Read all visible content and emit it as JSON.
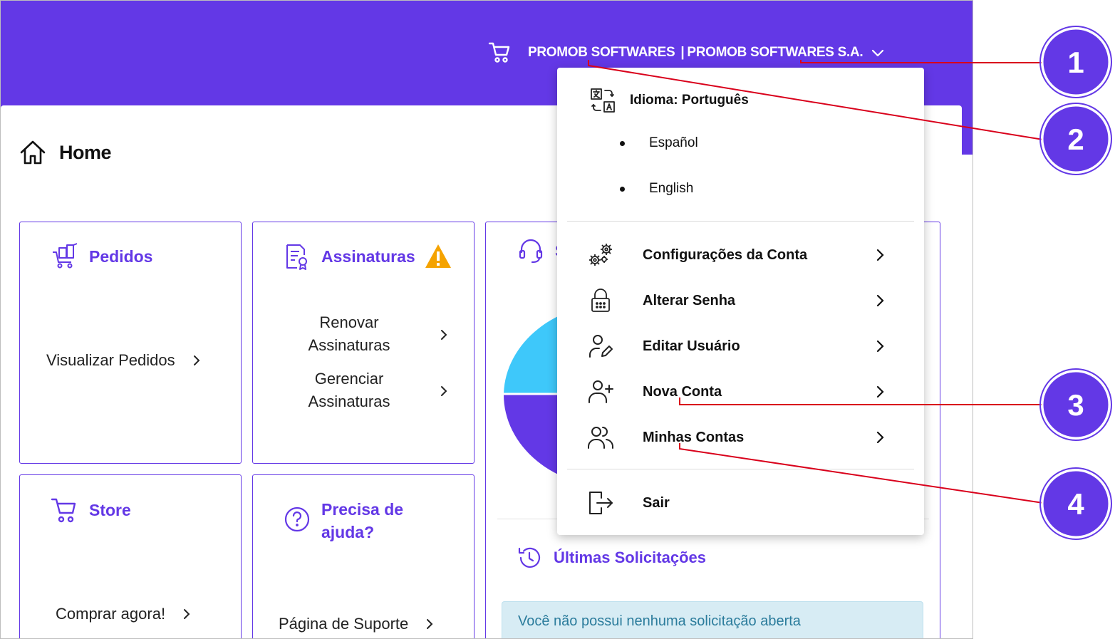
{
  "header": {
    "company_name": "PROMOB SOFTWARES",
    "separator": "|",
    "account_name": "PROMOB SOFTWARES S.A.",
    "cart_icon": "cart-icon",
    "dropdown_icon": "chevron-down-icon",
    "brand_color": "#6338e6"
  },
  "page": {
    "title": "Home",
    "icon": "home-icon"
  },
  "cards": {
    "pedidos": {
      "title": "Pedidos",
      "link": "Visualizar Pedidos",
      "icon": "cart-box-icon"
    },
    "assinaturas": {
      "title": "Assinaturas",
      "icon": "document-badge-icon",
      "warning_icon": "warning-icon",
      "links": [
        "Renovar Assinaturas",
        "Gerenciar Assinaturas"
      ]
    },
    "suporte": {
      "title_partial": "S",
      "icon": "headset-icon"
    },
    "store": {
      "title": "Store",
      "link": "Comprar agora!",
      "icon": "cart-icon"
    },
    "ajuda": {
      "title_line1": "Precisa de",
      "title_line2": "ajuda?",
      "link": "Página de Suporte",
      "icon": "question-icon"
    }
  },
  "ultimas": {
    "title": "Últimas Solicitações",
    "icon": "history-icon",
    "alert_text": "Você não possui nenhuma solicitação aberta"
  },
  "dropdown": {
    "language_label": "Idioma: Português",
    "language_icon": "translate-icon",
    "language_options": [
      "Español",
      "English"
    ],
    "items": [
      {
        "label": "Configurações da Conta",
        "icon": "gears-icon"
      },
      {
        "label": "Alterar Senha",
        "icon": "lock-icon"
      },
      {
        "label": "Editar Usuário",
        "icon": "user-edit-icon"
      },
      {
        "label": "Nova Conta",
        "icon": "user-add-icon"
      },
      {
        "label": "Minhas Contas",
        "icon": "users-icon"
      }
    ],
    "logout_label": "Sair",
    "logout_icon": "logout-icon"
  },
  "callouts": [
    "1",
    "2",
    "3",
    "4"
  ],
  "colors": {
    "accent": "#6338e6",
    "callout_line": "#d9001b",
    "warning": "#f5a300",
    "pie_cyan": "#3ec8fa"
  }
}
